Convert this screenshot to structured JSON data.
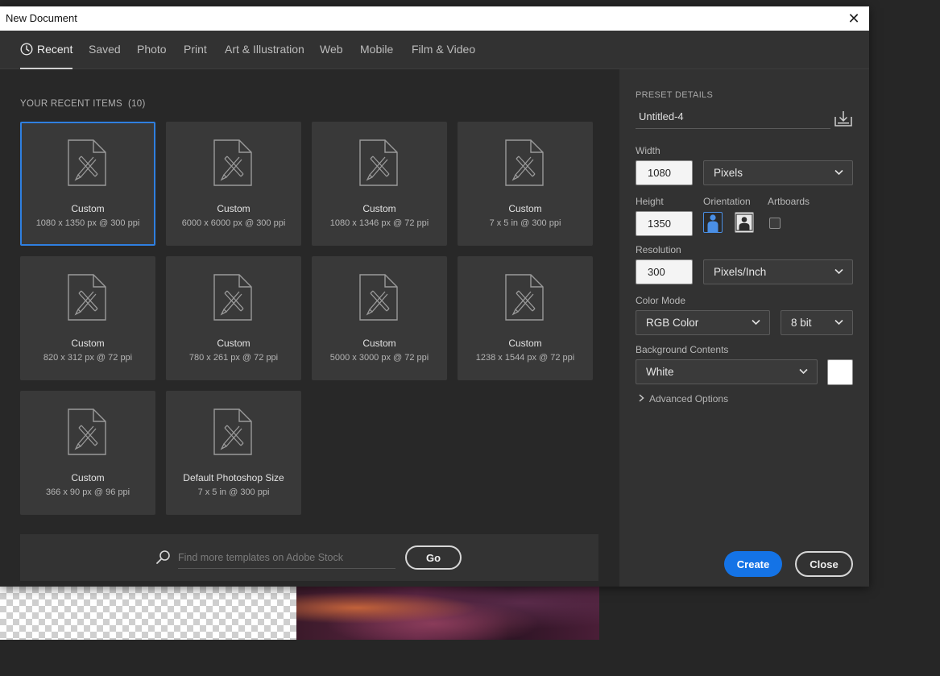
{
  "window": {
    "title": "New Document"
  },
  "tabs": [
    {
      "label": "Recent"
    },
    {
      "label": "Saved"
    },
    {
      "label": "Photo"
    },
    {
      "label": "Print"
    },
    {
      "label": "Art & Illustration"
    },
    {
      "label": "Web"
    },
    {
      "label": "Mobile"
    },
    {
      "label": "Film & Video"
    }
  ],
  "recent": {
    "heading": "YOUR RECENT ITEMS",
    "count": "(10)",
    "items": [
      {
        "name": "Custom",
        "dims": "1080 x 1350 px @ 300 ppi",
        "selected": true
      },
      {
        "name": "Custom",
        "dims": "6000 x 6000 px @ 300 ppi"
      },
      {
        "name": "Custom",
        "dims": "1080 x 1346 px @ 72 ppi"
      },
      {
        "name": "Custom",
        "dims": "7 x 5 in @ 300 ppi"
      },
      {
        "name": "Custom",
        "dims": "820 x 312 px @ 72 ppi"
      },
      {
        "name": "Custom",
        "dims": "780 x 261 px @ 72 ppi"
      },
      {
        "name": "Custom",
        "dims": "5000 x 3000 px @ 72 ppi"
      },
      {
        "name": "Custom",
        "dims": "1238 x 1544 px @ 72 ppi"
      },
      {
        "name": "Custom",
        "dims": "366 x 90 px @ 96 ppi"
      },
      {
        "name": "Default Photoshop Size",
        "dims": "7 x 5 in @ 300 ppi"
      }
    ]
  },
  "search": {
    "placeholder": "Find more templates on Adobe Stock",
    "go_label": "Go"
  },
  "preset": {
    "heading": "PRESET DETAILS",
    "name": "Untitled-4",
    "width_label": "Width",
    "width_value": "1080",
    "width_unit": "Pixels",
    "height_label": "Height",
    "height_value": "1350",
    "orientation_label": "Orientation",
    "artboards_label": "Artboards",
    "resolution_label": "Resolution",
    "resolution_value": "300",
    "resolution_unit": "Pixels/Inch",
    "color_mode_label": "Color Mode",
    "color_mode": "RGB Color",
    "bit_depth": "8 bit",
    "background_label": "Background Contents",
    "background": "White",
    "background_swatch": "#ffffff",
    "advanced_label": "Advanced Options"
  },
  "actions": {
    "create_label": "Create",
    "close_label": "Close"
  },
  "colors": {
    "accent": "#1473e6",
    "selection": "#2f7fe0"
  }
}
